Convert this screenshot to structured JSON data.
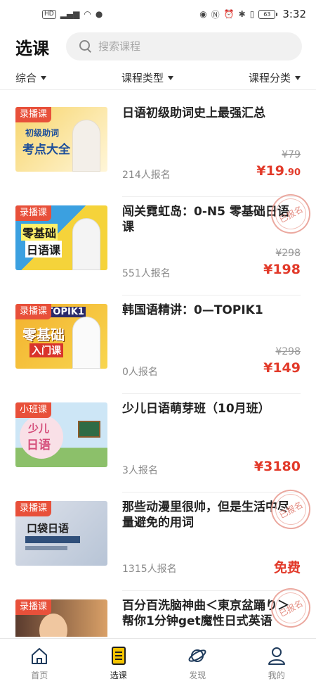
{
  "status": {
    "time": "3:32",
    "battery": "63",
    "hd": "HD",
    "network": "4G"
  },
  "header": {
    "title": "选课",
    "search_placeholder": "搜索课程"
  },
  "filters": [
    {
      "label": "综合"
    },
    {
      "label": "课程类型"
    },
    {
      "label": "课程分类"
    }
  ],
  "courses": [
    {
      "badge": "录播课",
      "title": "日语初级助词史上最强汇总",
      "enrolled": "214人报名",
      "original_price": "¥79",
      "price": "¥19",
      "price_cents": ".90",
      "registered": false,
      "thumb_lines": [
        "初级助词",
        "考点大全"
      ],
      "thumb_colors": [
        "#f7d56c",
        "#fff6d9"
      ]
    },
    {
      "badge": "录播课",
      "title": "闯关霓虹岛：0-N5 零基础日语课",
      "enrolled": "551人报名",
      "original_price": "¥298",
      "price": "¥198",
      "price_cents": "",
      "registered": true,
      "thumb_lines": [
        "零基础",
        "日语课"
      ],
      "thumb_colors": [
        "#3ba0e0",
        "#f5d33a"
      ]
    },
    {
      "badge": "录播课",
      "title": "韩国语精讲：0—TOPIK1",
      "enrolled": "0人报名",
      "original_price": "¥298",
      "price": "¥149",
      "price_cents": "",
      "registered": false,
      "thumb_lines": [
        "0-TOPIK1",
        "零基础",
        "入门课"
      ],
      "thumb_colors": [
        "#f3b12e",
        "#f8d64f"
      ]
    },
    {
      "badge": "小班课",
      "title": "少儿日语萌芽班（10月班）",
      "enrolled": "3人报名",
      "original_price": "",
      "price": "¥3180",
      "price_cents": "",
      "registered": false,
      "thumb_lines": [
        "少儿",
        "日语"
      ],
      "thumb_colors": [
        "#cde6f6",
        "#f9e0e7"
      ]
    },
    {
      "badge": "录播课",
      "title": "那些动漫里很帅，但是生活中尽量避免的用词",
      "enrolled": "1315人报名",
      "original_price": "",
      "price": "免费",
      "price_cents": "",
      "registered": true,
      "thumb_lines": [
        "口袋日语"
      ],
      "thumb_colors": [
        "#dde1ea",
        "#b7c4d6"
      ]
    },
    {
      "badge": "录播课",
      "title": "百分百洗脑神曲＜東京盆踊り＞帮你1分钟get魔性日式英语",
      "enrolled": "",
      "original_price": "",
      "price": "",
      "price_cents": "",
      "registered": true,
      "thumb_lines": [],
      "thumb_colors": [
        "#5a3b2e",
        "#d9a067"
      ]
    }
  ],
  "registered_stamp": "已报名",
  "tabs": [
    {
      "label": "首页",
      "icon": "home-icon",
      "active": false
    },
    {
      "label": "选课",
      "icon": "course-icon",
      "active": true
    },
    {
      "label": "发现",
      "icon": "planet-icon",
      "active": false
    },
    {
      "label": "我的",
      "icon": "user-icon",
      "active": false
    }
  ],
  "colors": {
    "accent_price": "#e23a2a",
    "badge_bg": "#e8503a",
    "active_tab": "#f5c400"
  }
}
